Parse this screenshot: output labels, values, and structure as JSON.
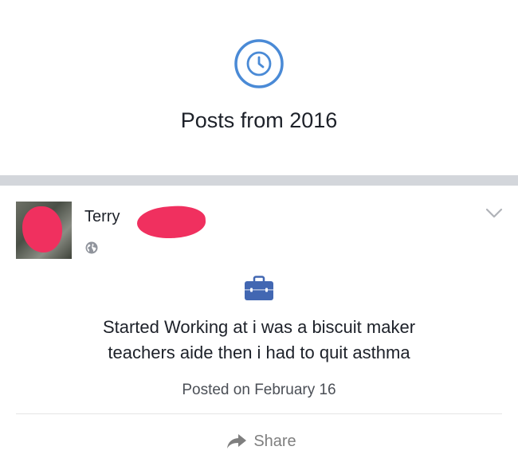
{
  "header": {
    "icon": "clock-icon",
    "title": "Posts from 2016"
  },
  "post": {
    "author": "Terry",
    "privacy_icon": "globe-icon",
    "menu_icon": "chevron-down-icon",
    "life_event_icon": "briefcase-icon",
    "text_lines": [
      "Started Working at i was a biscuit maker",
      "teachers aide then i had to quit asthma"
    ],
    "posted": "Posted on February 16",
    "share_label": "Share",
    "share_icon": "share-arrow-icon"
  },
  "colors": {
    "accent_blue": "#4267b2",
    "redaction_pink": "#f0305f",
    "divider_gray": "#d3d6db",
    "muted_text": "#7f7f7f"
  }
}
